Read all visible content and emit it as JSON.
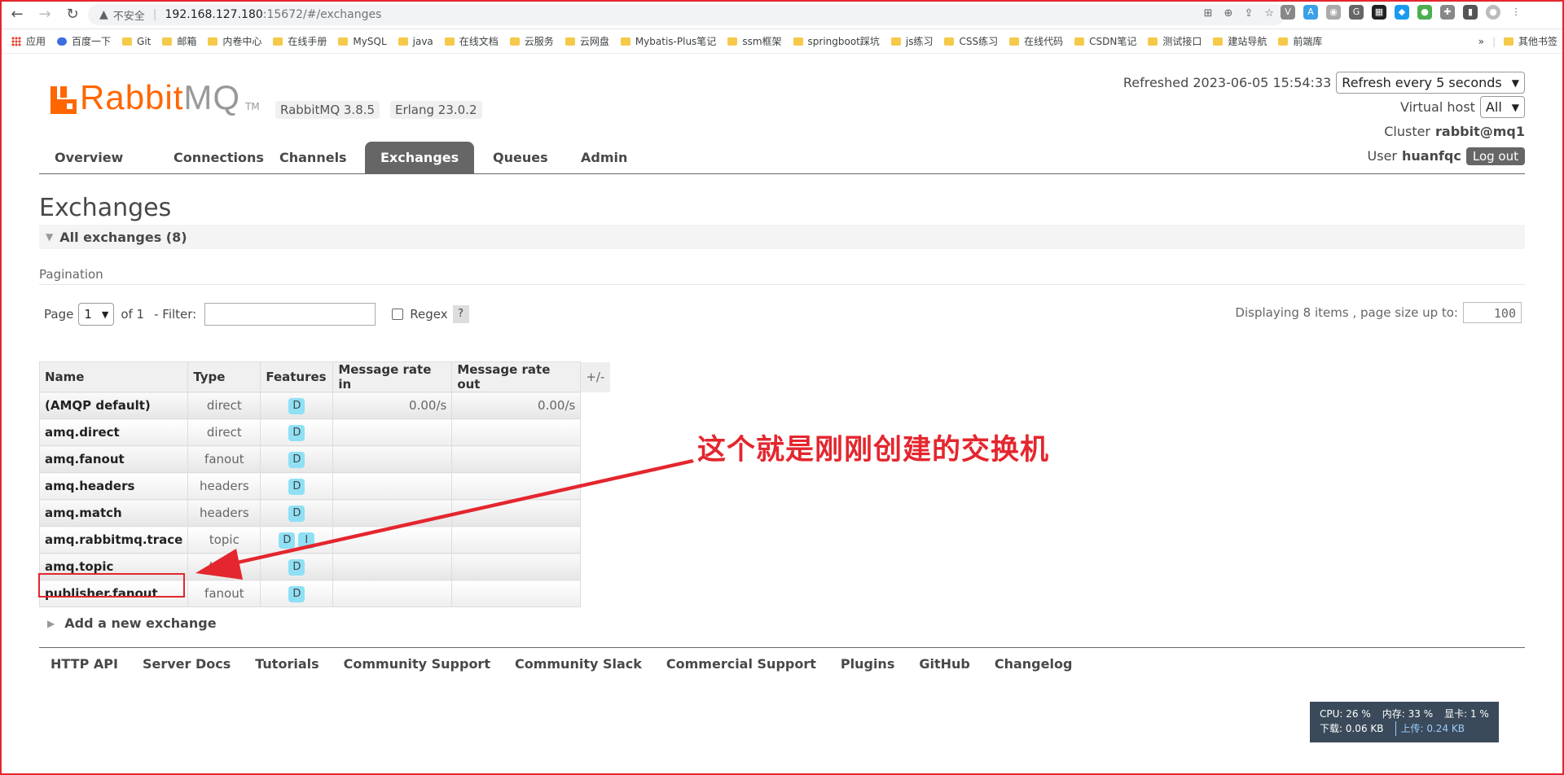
{
  "browser": {
    "insecure_label": "不安全",
    "url_host": "192.168.127.180",
    "url_rest": ":15672/#/exchanges"
  },
  "bookmarks": {
    "apps": "应用",
    "items": [
      "百度一下",
      "Git",
      "邮箱",
      "内卷中心",
      "在线手册",
      "MySQL",
      "java",
      "在线文档",
      "云服务",
      "云网盘",
      "Mybatis-Plus笔记",
      "ssm框架",
      "springboot踩坑",
      "js练习",
      "CSS练习",
      "在线代码",
      "CSDN笔记",
      "测试接口",
      "建站导航",
      "前端库"
    ],
    "overflow": "»",
    "other": "其他书签"
  },
  "header": {
    "logo_rabbit": "Rabbit",
    "logo_mq": "MQ",
    "logo_tm": "TM",
    "version": "RabbitMQ 3.8.5",
    "erlang": "Erlang 23.0.2",
    "refreshed_label": "Refreshed 2023-06-05 15:54:33",
    "refresh_select": "Refresh every 5 seconds",
    "vhost_label": "Virtual host",
    "vhost_value": "All",
    "cluster_label": "Cluster",
    "cluster_value": "rabbit@mq1",
    "user_label": "User",
    "user_value": "huanfqc",
    "logout": "Log out"
  },
  "tabs": [
    "Overview",
    "Connections",
    "Channels",
    "Exchanges",
    "Queues",
    "Admin"
  ],
  "active_tab": "Exchanges",
  "main": {
    "title": "Exchanges",
    "section": "All exchanges (8)",
    "pagination_label": "Pagination",
    "page_label": "Page",
    "page_value": "1",
    "of_label": "of 1",
    "filter_label": "- Filter:",
    "filter_value": "",
    "regex_label": "Regex",
    "help": "?",
    "displaying": "Displaying 8 items , page size up to:",
    "page_size": "100"
  },
  "table": {
    "headers": [
      "Name",
      "Type",
      "Features",
      "Message rate in",
      "Message rate out"
    ],
    "plusminus": "+/-",
    "rows": [
      {
        "name": "(AMQP default)",
        "type": "direct",
        "features": [
          "D"
        ],
        "rate_in": "0.00/s",
        "rate_out": "0.00/s"
      },
      {
        "name": "amq.direct",
        "type": "direct",
        "features": [
          "D"
        ],
        "rate_in": "",
        "rate_out": ""
      },
      {
        "name": "amq.fanout",
        "type": "fanout",
        "features": [
          "D"
        ],
        "rate_in": "",
        "rate_out": ""
      },
      {
        "name": "amq.headers",
        "type": "headers",
        "features": [
          "D"
        ],
        "rate_in": "",
        "rate_out": ""
      },
      {
        "name": "amq.match",
        "type": "headers",
        "features": [
          "D"
        ],
        "rate_in": "",
        "rate_out": ""
      },
      {
        "name": "amq.rabbitmq.trace",
        "type": "topic",
        "features": [
          "D",
          "I"
        ],
        "rate_in": "",
        "rate_out": ""
      },
      {
        "name": "amq.topic",
        "type": "topic",
        "features": [
          "D"
        ],
        "rate_in": "",
        "rate_out": ""
      },
      {
        "name": "publisher.fanout",
        "type": "fanout",
        "features": [
          "D"
        ],
        "rate_in": "",
        "rate_out": ""
      }
    ]
  },
  "annotation": {
    "text": "这个就是刚刚创建的交换机",
    "color": "#e4262e"
  },
  "add_exchange": "Add a new exchange",
  "footer_links": [
    "HTTP API",
    "Server Docs",
    "Tutorials",
    "Community Support",
    "Community Slack",
    "Commercial Support",
    "Plugins",
    "GitHub",
    "Changelog"
  ],
  "sysmon": {
    "cpu": "CPU: 26 %",
    "mem": "内存: 33 %",
    "gpu": "显卡: 1 %",
    "down": "下载: 0.06 KB",
    "up": "上传: 0.24 KB"
  },
  "colors": {
    "brand": "#ff6600",
    "tab_active": "#666666",
    "badge": "#8fe0f5"
  }
}
